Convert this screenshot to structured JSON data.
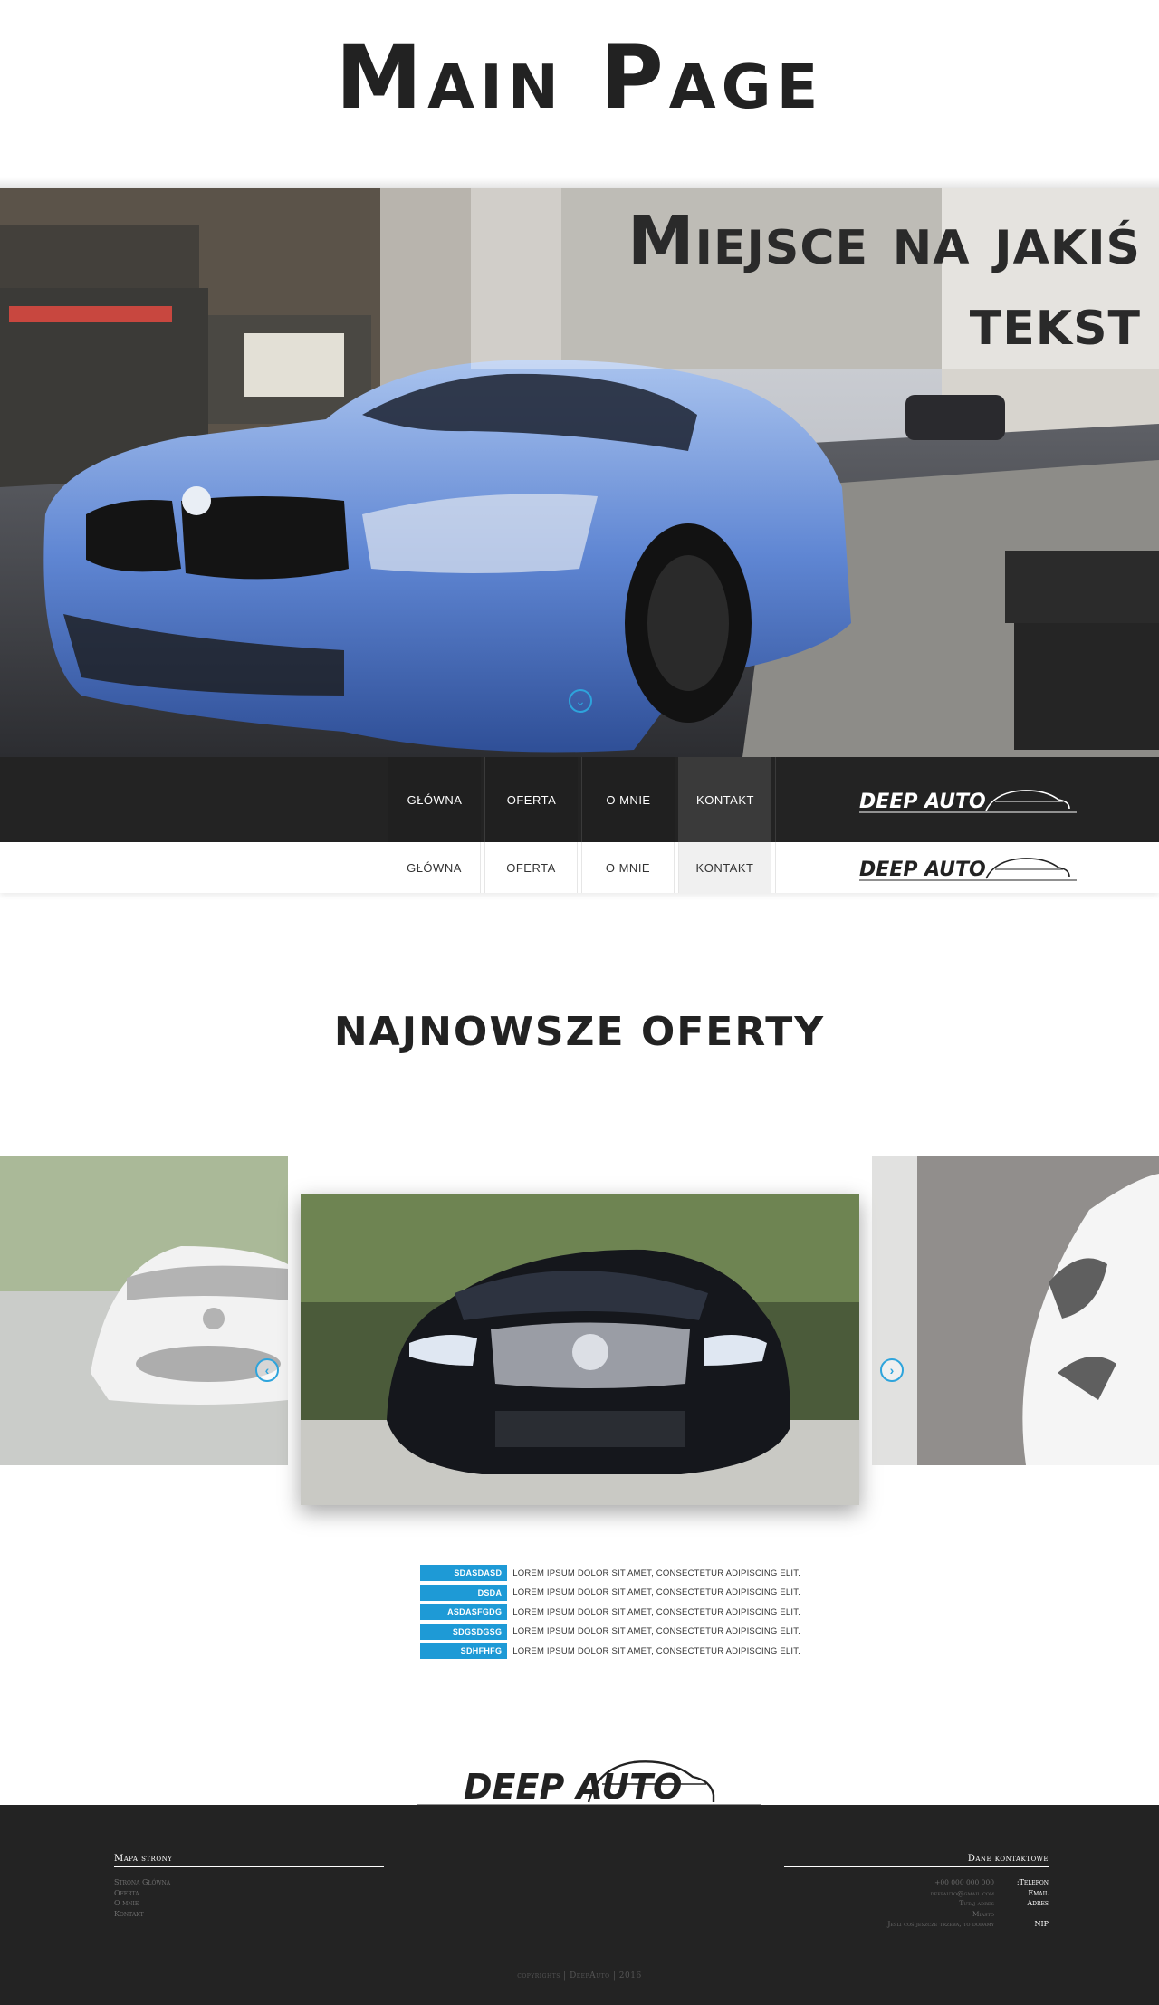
{
  "page": {
    "title": "Main Page"
  },
  "hero": {
    "headline_line1": "Miejsce na jakiś",
    "headline_line2": "tekst",
    "scroll_icon": "chevron-down-circle-icon",
    "accent_color": "#2ea4dc"
  },
  "nav": {
    "items": [
      "Główna",
      "Oferta",
      "O mnie",
      "Kontakt"
    ],
    "active": "Kontakt",
    "logo": "DEEP AUTO"
  },
  "offers": {
    "title": "NAJNOWSZE OFERTY",
    "prev_icon": "chevron-left-circle-icon",
    "next_icon": "chevron-right-circle-icon"
  },
  "specs": [
    {
      "key": "sdasdasd",
      "value": "Lorem ipsum dolor sit amet, consectetur adipiscing elit."
    },
    {
      "key": "dsda",
      "value": "Lorem ipsum dolor sit amet, consectetur adipiscing elit."
    },
    {
      "key": "asdasfgdg",
      "value": "Lorem ipsum dolor sit amet, consectetur adipiscing elit."
    },
    {
      "key": "sdgsdgsg",
      "value": "Lorem ipsum dolor sit amet, consectetur adipiscing elit."
    },
    {
      "key": "sdhfhfg",
      "value": "Lorem ipsum dolor sit amet, consectetur adipiscing elit."
    }
  ],
  "footer": {
    "logo": "DEEP AUTO",
    "sitemap_title": "Mapa strony",
    "sitemap_links": [
      "Strona Główna",
      "Oferta",
      "O mnie",
      "Kontakt"
    ],
    "contact_title": "Dane kontaktowe",
    "contact_values": [
      "+00 000 000 000",
      "deepauto@gmail.com",
      "Tutaj adres",
      "Miasto",
      "Jeśli coś jeszcze trzeba, to dodamy"
    ],
    "contact_labels": [
      ":Telefon",
      "Email",
      "Adres",
      "",
      "NIP"
    ],
    "copyright": "copyrights | DeepAuto | 2016"
  }
}
